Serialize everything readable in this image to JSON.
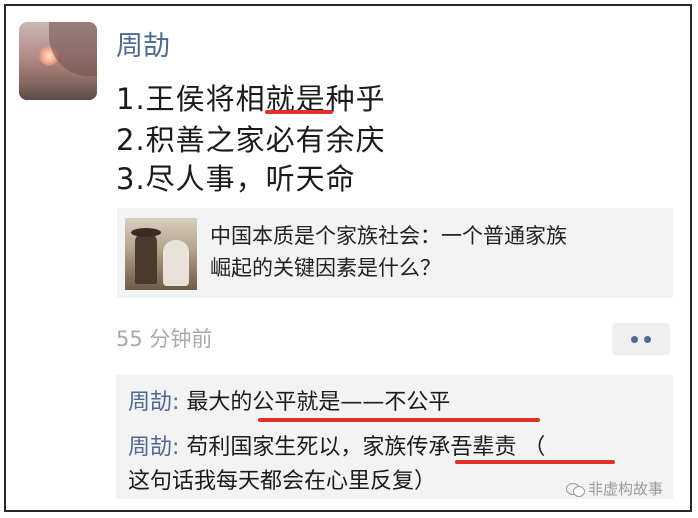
{
  "post": {
    "author": "周劼",
    "lines": [
      "1.王侯将相就是种乎",
      "2.积善之家必有余庆",
      "3.尽人事，听天命"
    ],
    "link": {
      "title_line1": "中国本质是个家族社会：一个普通家族",
      "title_line2": "崛起的关键因素是什么？"
    },
    "timestamp": "55 分钟前"
  },
  "comments": [
    {
      "author": "周劼",
      "sep": ": ",
      "text": "最大的公平就是——不公平"
    },
    {
      "author": "周劼",
      "sep": ": ",
      "text": "苟利国家生死以，家族传承吾辈责 （",
      "text_cont": "这句话我每天都会在心里反复）"
    }
  ],
  "watermark": {
    "text": "非虚构故事"
  },
  "colors": {
    "author_name": "#4f6a8f",
    "underline": "#e0302c",
    "panel_bg": "#f3f3f3",
    "timestamp": "#a9a9a9"
  }
}
